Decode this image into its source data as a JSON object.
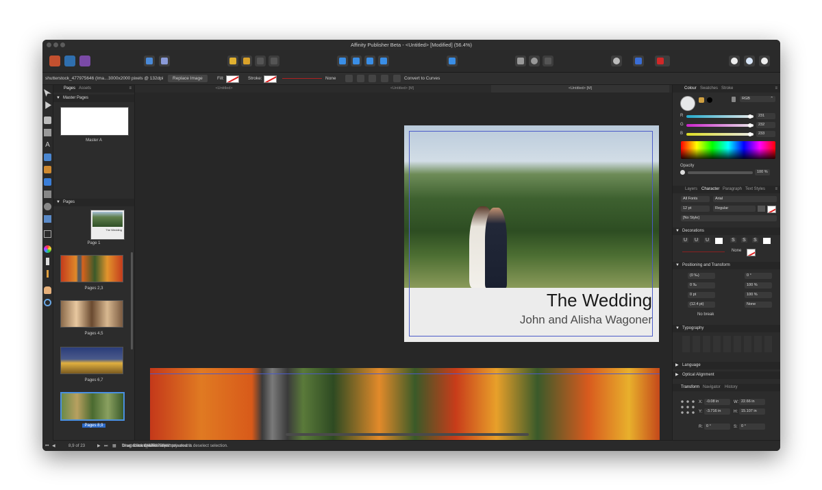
{
  "window": {
    "title": "Affinity Publisher Beta - <Untitled> [Modified] (56.4%)"
  },
  "context_bar": {
    "selection": "shutterstock_477975646 (Ima...",
    "dimensions": "3000x2000 pixels @ 132dpi",
    "replace_image": "Replace Image",
    "fill_label": "Fill:",
    "stroke_label": "Stroke:",
    "stroke_none": "None",
    "convert_curves": "Convert to Curves"
  },
  "left_panel": {
    "tabs": [
      "Pages",
      "Assets"
    ],
    "master_header": "Master Pages",
    "master_label": "Master A",
    "pages_header": "Pages",
    "pages": [
      "Page 1",
      "Pages 2,3",
      "Pages 4,5",
      "Pages 6,7",
      "Pages 8,9"
    ]
  },
  "doc_tabs": [
    "<Untitled>",
    "<Untitled> [M]",
    "<Untitled> [M]"
  ],
  "document": {
    "title": "The Wedding",
    "subtitle": "John and Alisha Wagoner"
  },
  "right_panel": {
    "colour_tabs": [
      "Colour",
      "Swatches",
      "Stroke"
    ],
    "color_model": "RGB",
    "r": {
      "label": "R",
      "value": "231"
    },
    "g": {
      "label": "G",
      "value": "232"
    },
    "b": {
      "label": "B",
      "value": "233"
    },
    "opacity_label": "Opacity",
    "opacity_value": "100 %",
    "text_tabs": [
      "Layers",
      "Character",
      "Paragraph",
      "Text Styles"
    ],
    "font_collection": "All Fonts",
    "font_name": "Arial",
    "font_size": "12 pt",
    "font_style": "Regular",
    "char_style": "[No Style]",
    "decorations_header": "Decorations",
    "deco_none": "None",
    "positioning_header": "Positioning and Transform",
    "pos_fields": [
      "(0 ‰)",
      "0 ‰",
      "0 pt",
      "(12.4 pt)"
    ],
    "pos_fields_right": [
      "0 °",
      "100 %",
      "100 %",
      "None"
    ],
    "no_break": "No break",
    "typography_header": "Typography",
    "language_header": "Language",
    "optical_header": "Optical Alignment",
    "transform_tabs": [
      "Transform",
      "Navigator",
      "History"
    ],
    "x": "-0.08 in",
    "y": "-3.716 in",
    "w": "22.66 in",
    "h": "15.107 in",
    "r_rot": "0 °",
    "s_shear": "0 °"
  },
  "status": {
    "page_count": "8,9 of 23",
    "message_1": "'shutterstock_477975646' selected.",
    "message_2": "Drag",
    "message_3": "to move selection.",
    "message_4": "Click",
    "message_5": "another object to select it.",
    "message_6": "Click",
    "message_7": "on an empty area to deselect selection."
  }
}
